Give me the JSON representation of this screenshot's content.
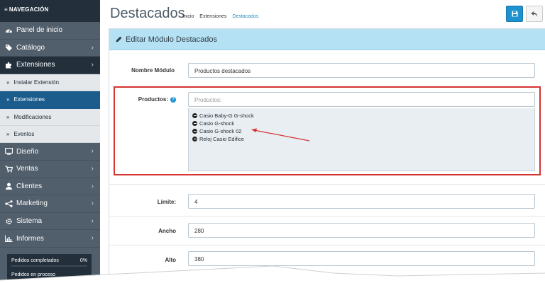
{
  "sidebar": {
    "header": "NAVEGACIÓN",
    "items": [
      {
        "label": "Panel de inicio",
        "icon": "dashboard-icon"
      },
      {
        "label": "Catálogo",
        "icon": "tag-icon"
      },
      {
        "label": "Extensiones",
        "icon": "puzzle-icon"
      },
      {
        "label": "Diseño",
        "icon": "monitor-icon"
      },
      {
        "label": "Ventas",
        "icon": "cart-icon"
      },
      {
        "label": "Clientes",
        "icon": "user-icon"
      },
      {
        "label": "Marketing",
        "icon": "share-icon"
      },
      {
        "label": "Sistema",
        "icon": "gear-icon"
      },
      {
        "label": "Informes",
        "icon": "bar-chart-icon"
      }
    ],
    "subitems": [
      {
        "label": "Instalar Extensión"
      },
      {
        "label": "Extensiones"
      },
      {
        "label": "Modificaciones"
      },
      {
        "label": "Eventos"
      }
    ],
    "stats": {
      "completed_label": "Pedidos completados",
      "completed_value": "0%",
      "processing_label": "Pedidos en proceso"
    }
  },
  "header": {
    "title": "Destacados",
    "breadcrumb": [
      "Inicio",
      "Extensiones",
      "Destacados"
    ]
  },
  "panel": {
    "title": "Editar Módulo Destacados"
  },
  "form": {
    "name_label": "Nombre Módulo",
    "name_value": "Productos destacados",
    "products_label": "Productos:",
    "products_placeholder": "Productos:",
    "products": [
      "Casio Baby-G G-shock",
      "Casio G-shock",
      "Casio G-shock 02",
      "Reloj Casio Edifice"
    ],
    "limit_label": "Límite:",
    "limit_value": "4",
    "width_label": "Ancho",
    "width_value": "280",
    "height_label": "Alto",
    "height_value": "380"
  },
  "colors": {
    "sidebar": "#515e6b",
    "sidebar_dark": "#23303c",
    "accent": "#1e91cf",
    "panel_head": "#b5e1f5",
    "highlight": "#d63333"
  }
}
